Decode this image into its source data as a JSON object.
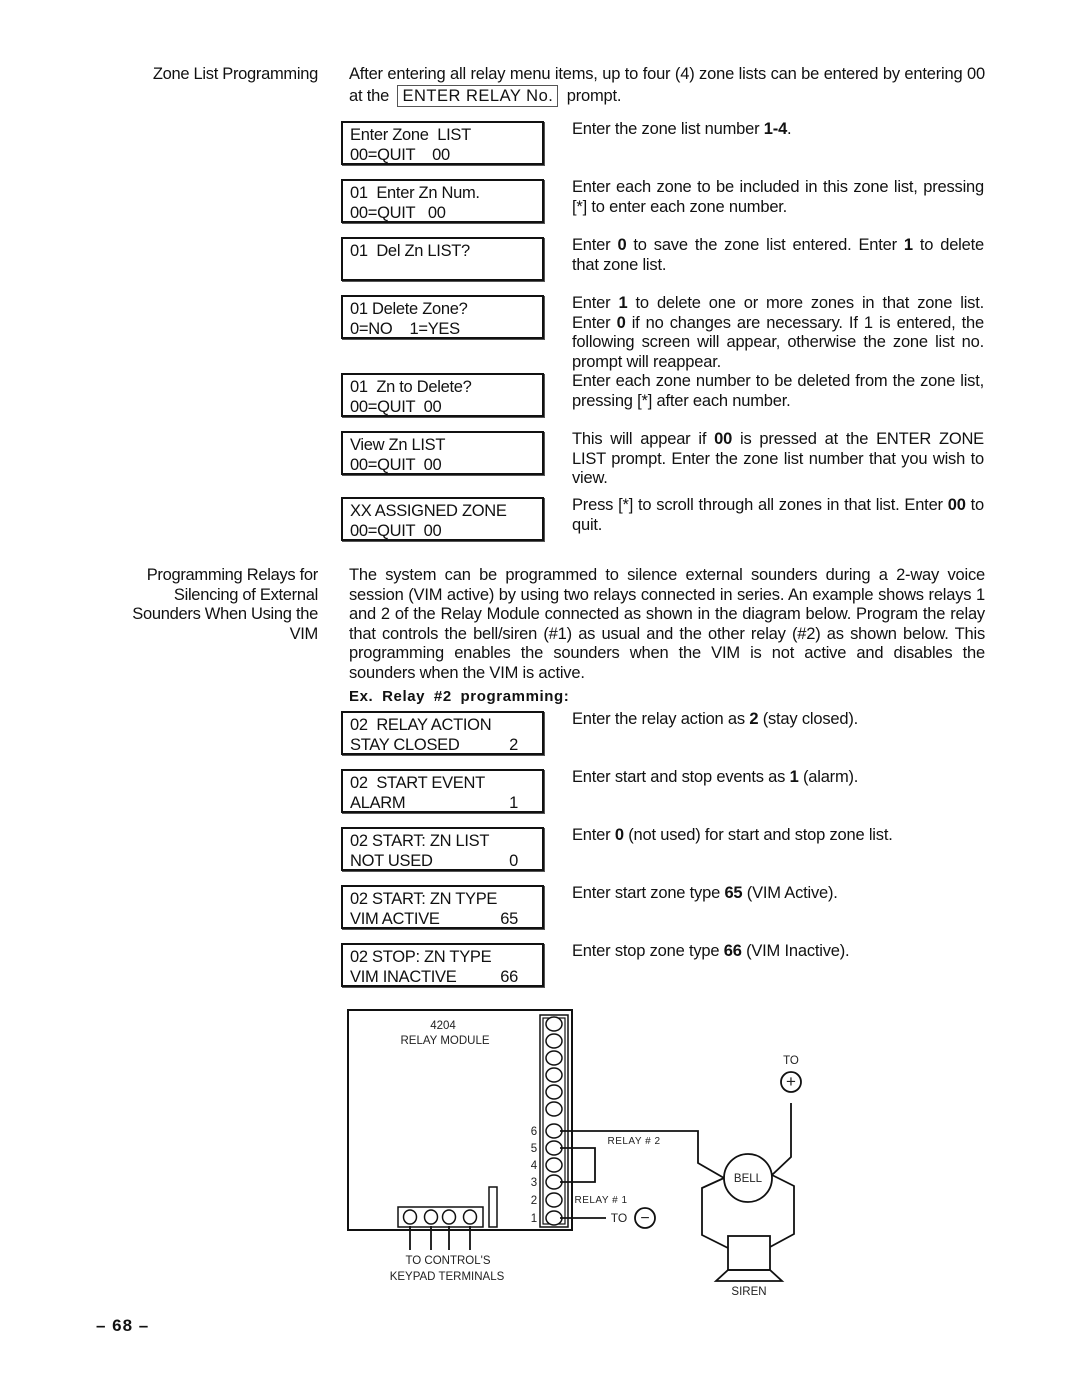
{
  "zone_list": {
    "side_label": "Zone List Programming",
    "intro_before": "After entering all relay menu items, up to four (4) zone lists can be entered by entering 00 at the",
    "intro_box": "ENTER RELAY No.",
    "intro_after": "prompt.",
    "steps": [
      {
        "lcd": [
          "Enter Zone  LIST",
          "00=QUIT    00"
        ],
        "desc": [
          {
            "t": "Enter the zone list number "
          },
          {
            "t": "1-4",
            "b": true
          },
          {
            "t": "."
          }
        ]
      },
      {
        "lcd": [
          "01  Enter Zn Num.",
          "00=QUIT   00"
        ],
        "desc": [
          {
            "t": "Enter each zone to be included in this zone list, pressing [*] to enter each zone number."
          }
        ]
      },
      {
        "lcd": [
          "01  Del Zn LIST?",
          ""
        ],
        "desc": [
          {
            "t": "Enter "
          },
          {
            "t": "0",
            "b": true
          },
          {
            "t": " to save the zone list entered. Enter "
          },
          {
            "t": "1",
            "b": true
          },
          {
            "t": " to delete that zone list."
          }
        ]
      },
      {
        "lcd": [
          "01 Delete Zone?",
          "0=NO    1=YES"
        ],
        "desc": [
          {
            "t": "Enter "
          },
          {
            "t": "1",
            "b": true
          },
          {
            "t": " to delete one or more zones in that zone list. Enter "
          },
          {
            "t": "0",
            "b": true
          },
          {
            "t": " if no changes are necessary. If 1 is entered, the following screen will appear, otherwise the zone list no. prompt will reappear."
          }
        ]
      },
      {
        "lcd": [
          "01  Zn to Delete?",
          "00=QUIT  00"
        ],
        "desc": [
          {
            "t": "Enter each zone number to be deleted from the zone list, pressing [*] after each number."
          }
        ]
      },
      {
        "lcd": [
          "View Zn LIST",
          "00=QUIT  00"
        ],
        "desc": [
          {
            "t": "This will appear if "
          },
          {
            "t": "00",
            "b": true
          },
          {
            "t": " is pressed at the ENTER ZONE LIST prompt. Enter the zone list number that you wish to view."
          }
        ]
      },
      {
        "lcd": [
          "XX ASSIGNED ZONE",
          "00=QUIT  00"
        ],
        "desc": [
          {
            "t": "Press [*] to scroll through all zones in that list. Enter "
          },
          {
            "t": "00",
            "b": true
          },
          {
            "t": " to quit."
          }
        ]
      }
    ]
  },
  "vim_section": {
    "side_label": [
      "Programming Relays for",
      "Silencing of External",
      "Sounders When Using the",
      "VIM"
    ],
    "body": "The system can be programmed to silence external sounders during a 2-way voice session (VIM active) by using two relays connected in series. An example shows relays 1 and 2 of the Relay Module connected as shown in the diagram below. Program the relay that controls the bell/siren (#1) as usual and the other relay (#2) as shown below. This programming enables the sounders when the VIM is not active and disables the sounders when the VIM is active.",
    "example_heading": "Ex.  Relay #2 programming:",
    "steps": [
      {
        "line1": "02  RELAY ACTION",
        "label": "STAY CLOSED",
        "value": "2",
        "desc": [
          {
            "t": "Enter the relay action as "
          },
          {
            "t": "2",
            "b": true
          },
          {
            "t": " (stay closed)."
          }
        ]
      },
      {
        "line1": "02  START EVENT",
        "label": "ALARM",
        "value": "1",
        "desc": [
          {
            "t": "Enter start and stop events as "
          },
          {
            "t": "1",
            "b": true
          },
          {
            "t": " (alarm)."
          }
        ]
      },
      {
        "line1": "02 START: ZN LIST",
        "label": "NOT USED",
        "value": "0",
        "desc": [
          {
            "t": "Enter "
          },
          {
            "t": "0",
            "b": true
          },
          {
            "t": " (not used) for start and stop zone list."
          }
        ]
      },
      {
        "line1": "02 START: ZN TYPE",
        "label": "VIM ACTIVE",
        "value": "65",
        "desc": [
          {
            "t": "Enter start zone type "
          },
          {
            "t": "65",
            "b": true
          },
          {
            "t": " (VIM Active)."
          }
        ]
      },
      {
        "line1": "02 STOP: ZN TYPE",
        "label": "VIM INACTIVE",
        "value": "66",
        "desc": [
          {
            "t": "Enter stop zone type "
          },
          {
            "t": "66",
            "b": true
          },
          {
            "t": " (VIM Inactive)."
          }
        ]
      }
    ]
  },
  "diagram": {
    "module_model": "4204",
    "module_name": "RELAY  MODULE",
    "terminal_numbers": [
      "6",
      "5",
      "4",
      "3",
      "2",
      "1"
    ],
    "relay2_label": "RELAY # 2",
    "relay1_label": "RELAY # 1",
    "to_label": "TO",
    "plus_symbol": "+",
    "minus_symbol": "−",
    "bell_label": "BELL",
    "siren_label": "SIREN",
    "keypad_label_line1": "TO CONTROL'S",
    "keypad_label_line2": "KEYPAD TERMINALS"
  },
  "footer": {
    "page_number": "–  68  –"
  }
}
